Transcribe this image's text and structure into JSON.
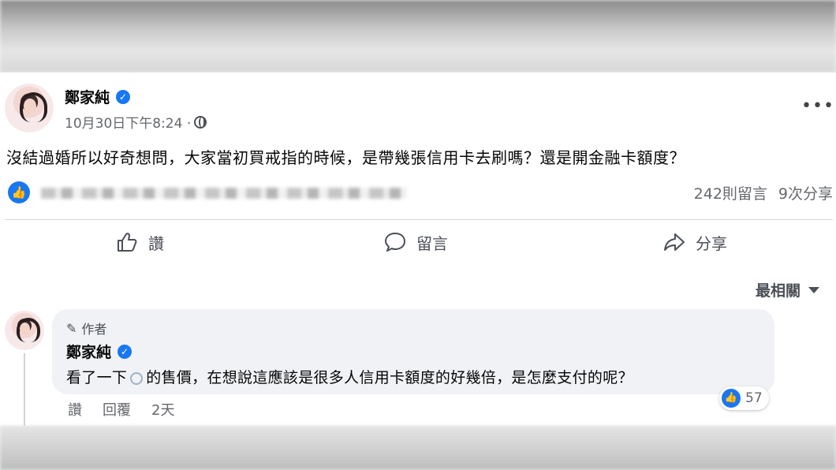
{
  "post": {
    "author": "鄭家純",
    "timestamp": "10月30日下午8:24 · ",
    "more": "•••",
    "text": "沒結過婚所以好奇想問，大家當初買戒指的時候，是帶幾張信用卡去刷嗎？還是開金融卡額度？",
    "comment_count": "242則留言",
    "share_count": "9次分享"
  },
  "actions": {
    "like": "讚",
    "comment": "留言",
    "share": "分享"
  },
  "sort": {
    "label": "最相關"
  },
  "comment": {
    "author_tag": "作者",
    "author": "鄭家純",
    "text_before": "看了一下",
    "text_after": "的售價，在想說這應該是很多人信用卡額度的好幾倍，是怎麼支付的呢？",
    "like_count": "57",
    "like_action": "讚",
    "reply_action": "回覆",
    "time": "2天"
  },
  "icons": {
    "verified": "verified-badge-icon",
    "globe": "globe-icon",
    "like": "thumbs-up-icon",
    "comment": "speech-bubble-icon",
    "share": "share-arrow-icon",
    "pencil": "pencil-icon"
  },
  "colors": {
    "brand_blue": "#1877f2",
    "secondary_text": "#65676b",
    "bubble_bg": "#f0f2f5"
  }
}
